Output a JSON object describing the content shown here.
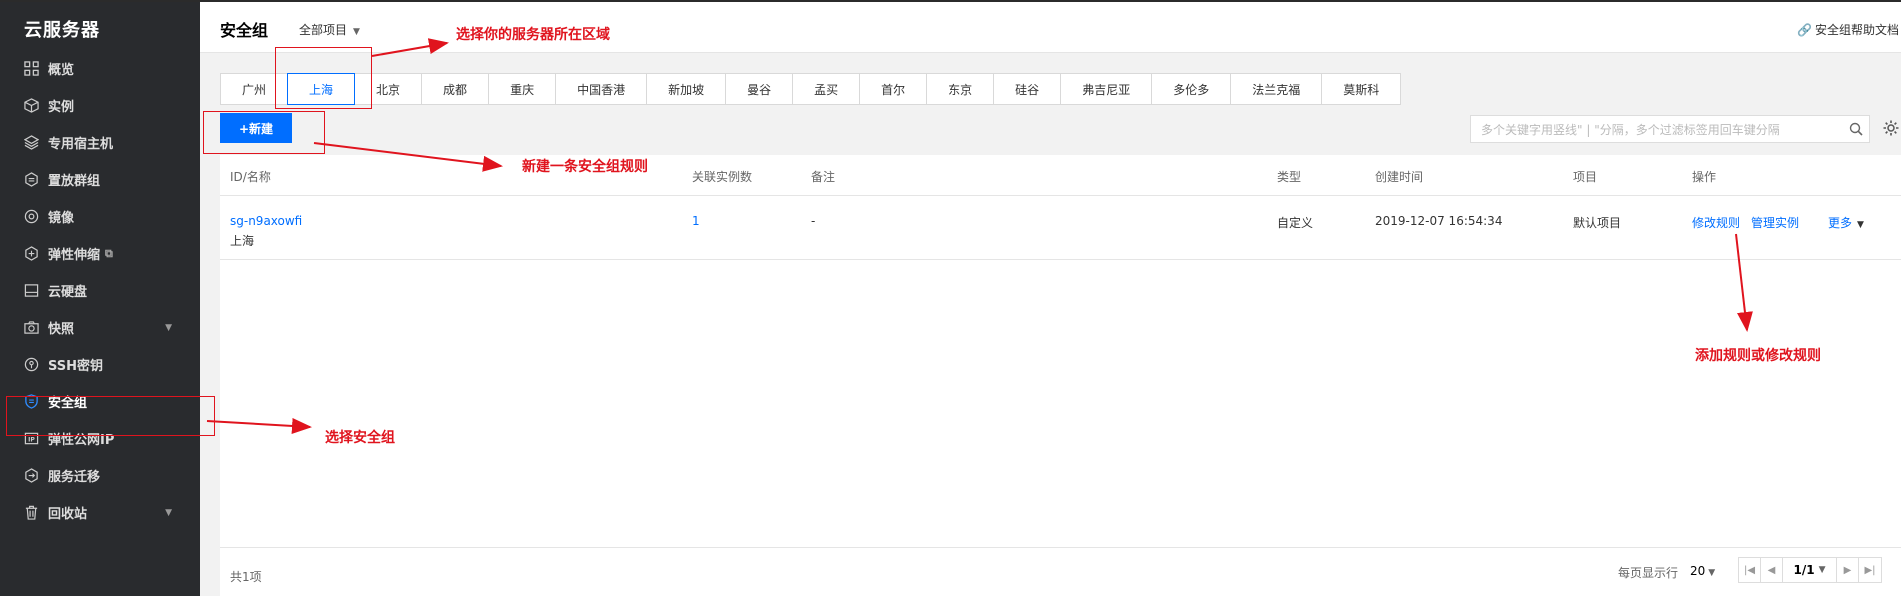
{
  "sidebar": {
    "title": "云服务器",
    "items": [
      {
        "label": "概览",
        "icon": "grid-icon"
      },
      {
        "label": "实例",
        "icon": "cube-icon"
      },
      {
        "label": "专用宿主机",
        "icon": "layers-icon"
      },
      {
        "label": "置放群组",
        "icon": "hexagon-icon"
      },
      {
        "label": "镜像",
        "icon": "disc-icon"
      },
      {
        "label": "弹性伸缩",
        "icon": "scale-icon",
        "external": "⧉"
      },
      {
        "label": "云硬盘",
        "icon": "disk-icon"
      },
      {
        "label": "快照",
        "icon": "camera-icon",
        "arrow": "▼"
      },
      {
        "label": "SSH密钥",
        "icon": "key-icon"
      },
      {
        "label": "安全组",
        "icon": "shield-icon",
        "active": true
      },
      {
        "label": "弹性公网IP",
        "icon": "ip-icon"
      },
      {
        "label": "服务迁移",
        "icon": "migrate-icon"
      },
      {
        "label": "回收站",
        "icon": "trash-icon",
        "arrow": "▼"
      }
    ]
  },
  "header": {
    "title": "安全组",
    "project_select": "全部项目",
    "help_link": "安全组帮助文档"
  },
  "regions": [
    "广州",
    "上海",
    "北京",
    "成都",
    "重庆",
    "中国香港",
    "新加坡",
    "曼谷",
    "孟买",
    "首尔",
    "东京",
    "硅谷",
    "弗吉尼亚",
    "多伦多",
    "法兰克福",
    "莫斯科"
  ],
  "active_region": "上海",
  "toolbar": {
    "new_button": "+新建",
    "search_placeholder": "多个关键字用竖线\" | \"分隔，多个过滤标签用回车键分隔"
  },
  "table": {
    "columns": {
      "id_name": "ID/名称",
      "instances": "关联实例数",
      "remark": "备注",
      "type": "类型",
      "created": "创建时间",
      "project": "项目",
      "actions": "操作"
    },
    "rows": [
      {
        "id": "sg-n9axowfi",
        "name": "上海",
        "instances": "1",
        "remark": "-",
        "type": "自定义",
        "created": "2019-12-07 16:54:34",
        "project": "默认项目",
        "action_modify": "修改规则",
        "action_manage": "管理实例",
        "action_more": "更多"
      }
    ]
  },
  "footer": {
    "total": "共1项",
    "per_page_label": "每页显示行",
    "per_page_value": "20",
    "page": "1/1"
  },
  "annotations": {
    "region": "选择你的服务器所在区域",
    "new_rule": "新建一条安全组规则",
    "select_group": "选择安全组",
    "modify_rule": "添加规则或修改规则"
  },
  "colors": {
    "accent": "#006eff",
    "sidebar_bg": "#292b2e",
    "annotation": "#e0141e"
  }
}
